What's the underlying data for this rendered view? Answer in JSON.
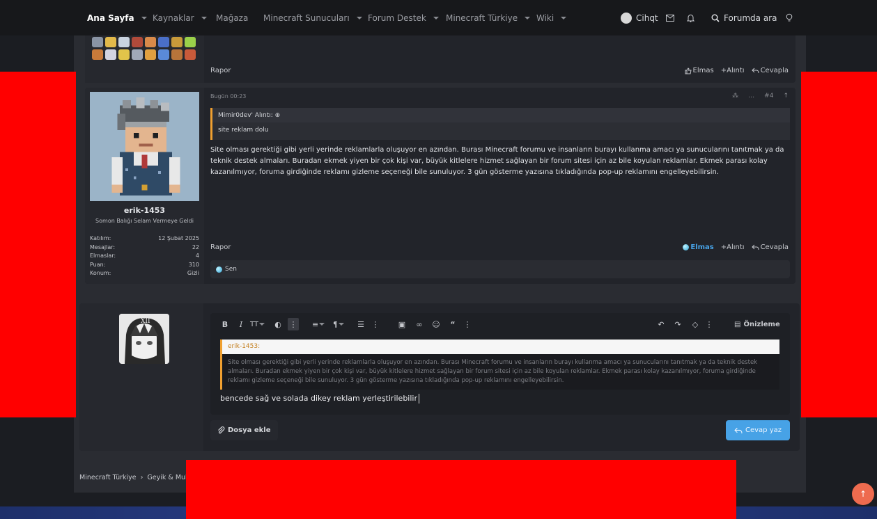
{
  "nav": {
    "items": [
      {
        "label": "Ana Sayfa",
        "active": true,
        "dropdown": true
      },
      {
        "label": "Kaynaklar",
        "dropdown": true
      },
      {
        "label": "Mağaza",
        "dropdown": false
      },
      {
        "label": "Minecraft Sunucuları",
        "dropdown": true
      },
      {
        "label": "Forum Destek",
        "dropdown": true
      },
      {
        "label": "Minecraft Türkiye",
        "dropdown": true
      },
      {
        "label": "Wiki",
        "dropdown": true
      }
    ],
    "logout_label": "Cihqt",
    "search_label": "Forumda ara"
  },
  "prev_post": {
    "report_label": "Rapor",
    "actions": {
      "like": "Elmas",
      "quote": "+Alıntı",
      "reply": "Cevapla"
    }
  },
  "post": {
    "time": "Bugün 00:23",
    "number": "#4",
    "quote_author": "Mimir0dev' Alıntı:",
    "quote_text": "site reklam dolu",
    "message": "Site olması gerektiği gibi yerli yerinde reklamlarla oluşuyor en azından. Burası Minecraft forumu ve insanların burayı kullanma amacı ya sunucularını tanıtmak ya da teknik destek almaları. Buradan ekmek yiyen bir çok kişi var, büyük kitlelere hizmet sağlayan bir forum sitesi için az bile koyulan reklamlar. Ekmek parası kolay kazanılmıyor, foruma girdiğinde reklamı gizleme seçeneği bile sunuluyor. 3 gün gösterme yazısına tıkladığında pop-up reklamını engelleyebilirsin.",
    "report_label": "Rapor",
    "actions": {
      "like": "Elmas",
      "quote": "+Alıntı",
      "reply": "Cevapla"
    },
    "reactions_text": "Sen",
    "user": {
      "name": "erik-1453",
      "title": "Somon Balığı Selam Vermeye Geldi",
      "stats": [
        {
          "label": "Katılım:",
          "value": "12 Şubat 2025"
        },
        {
          "label": "Mesajlar:",
          "value": "22"
        },
        {
          "label": "Elmaslar:",
          "value": "4"
        },
        {
          "label": "Puan:",
          "value": "310"
        },
        {
          "label": "Konum:",
          "value": "Gizli"
        }
      ]
    }
  },
  "editor": {
    "quote_author": "erik-1453:",
    "quote_text": "Site olması gerektiği gibi yerli yerinde reklamlarla oluşuyor en azından. Burası Minecraft forumu ve insanların burayı kullanma amacı ya sunucularını tanıtmak ya da teknik destek almaları. Buradan ekmek yiyen bir çok kişi var, büyük kitlelere hizmet sağlayan bir forum sitesi için az bile koyulan reklamlar. Ekmek parası kolay kazanılmıyor, foruma girdiğinde reklamı gizleme seçeneği bile sunuluyor. 3 gün gösterme yazısına tıkladığında pop-up reklamını engelleyebilirsin.",
    "typed_text": "bencede sağ ve solada dikey reklam yerleştirilebilir",
    "preview_label": "Önizleme",
    "attach_label": "Dosya ekle",
    "send_label": "Cevap yaz"
  },
  "breadcrumb": [
    "Minecraft Türkiye",
    "Geyik & Muh"
  ],
  "colors": {
    "accent": "#47a2e6",
    "quote_border": "#f0a030",
    "ad": "#ff0000",
    "fab": "#ee6b4f"
  }
}
